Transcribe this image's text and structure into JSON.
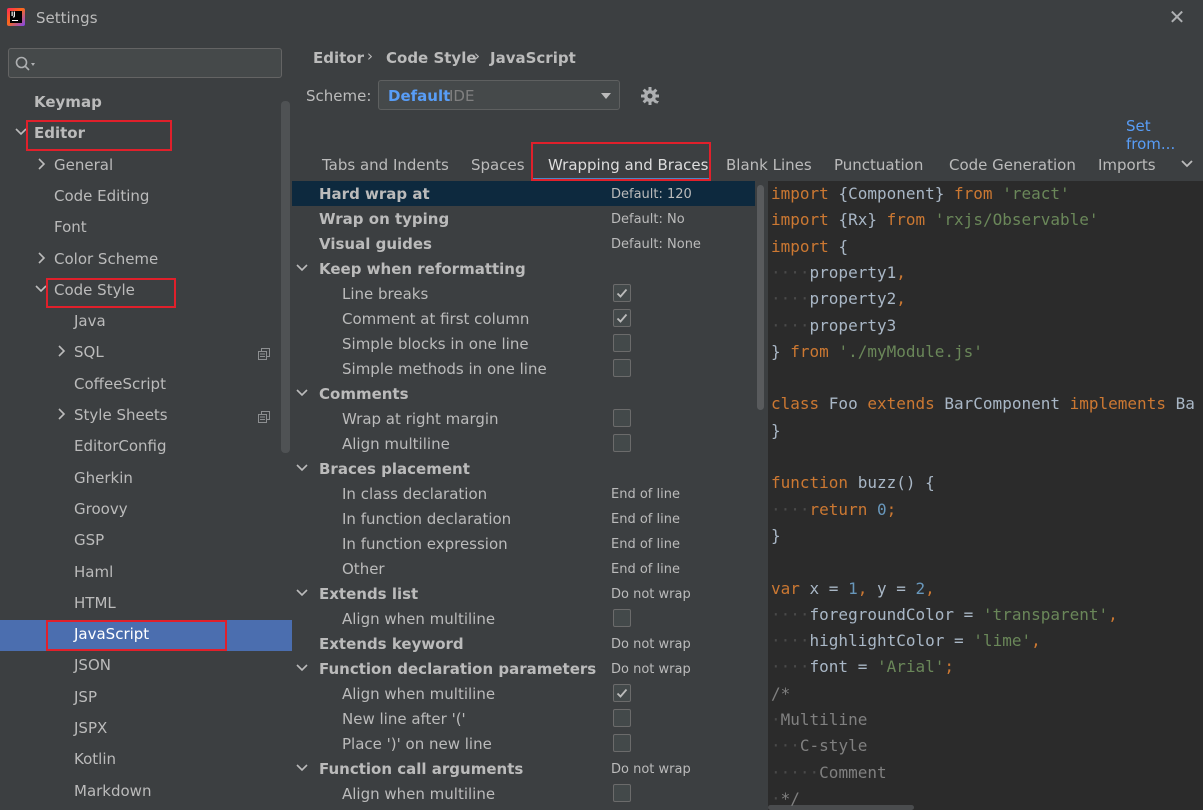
{
  "window": {
    "title": "Settings"
  },
  "search": {
    "placeholder": ""
  },
  "tree": [
    {
      "label": "Keymap",
      "bold": true,
      "indent": 0,
      "arrow": "none"
    },
    {
      "label": "Editor",
      "bold": true,
      "indent": 0,
      "arrow": "down"
    },
    {
      "label": "General",
      "bold": false,
      "indent": 1,
      "arrow": "right"
    },
    {
      "label": "Code Editing",
      "bold": false,
      "indent": 1,
      "arrow": "none"
    },
    {
      "label": "Font",
      "bold": false,
      "indent": 1,
      "arrow": "none"
    },
    {
      "label": "Color Scheme",
      "bold": false,
      "indent": 1,
      "arrow": "right"
    },
    {
      "label": "Code Style",
      "bold": false,
      "indent": 1,
      "arrow": "down"
    },
    {
      "label": "Java",
      "bold": false,
      "indent": 2,
      "arrow": "none"
    },
    {
      "label": "SQL",
      "bold": false,
      "indent": 2,
      "arrow": "right",
      "copy": true
    },
    {
      "label": "CoffeeScript",
      "bold": false,
      "indent": 2,
      "arrow": "none"
    },
    {
      "label": "Style Sheets",
      "bold": false,
      "indent": 2,
      "arrow": "right",
      "copy": true
    },
    {
      "label": "EditorConfig",
      "bold": false,
      "indent": 2,
      "arrow": "none"
    },
    {
      "label": "Gherkin",
      "bold": false,
      "indent": 2,
      "arrow": "none"
    },
    {
      "label": "Groovy",
      "bold": false,
      "indent": 2,
      "arrow": "none"
    },
    {
      "label": "GSP",
      "bold": false,
      "indent": 2,
      "arrow": "none"
    },
    {
      "label": "Haml",
      "bold": false,
      "indent": 2,
      "arrow": "none"
    },
    {
      "label": "HTML",
      "bold": false,
      "indent": 2,
      "arrow": "none"
    },
    {
      "label": "JavaScript",
      "bold": false,
      "indent": 2,
      "arrow": "none",
      "selected": true
    },
    {
      "label": "JSON",
      "bold": false,
      "indent": 2,
      "arrow": "none"
    },
    {
      "label": "JSP",
      "bold": false,
      "indent": 2,
      "arrow": "none"
    },
    {
      "label": "JSPX",
      "bold": false,
      "indent": 2,
      "arrow": "none"
    },
    {
      "label": "Kotlin",
      "bold": false,
      "indent": 2,
      "arrow": "none"
    },
    {
      "label": "Markdown",
      "bold": false,
      "indent": 2,
      "arrow": "none"
    }
  ],
  "breadcrumb": [
    "Editor",
    "Code Style",
    "JavaScript"
  ],
  "scheme": {
    "label": "Scheme:",
    "value": "Default",
    "suffix": "IDE"
  },
  "set_from": "Set from...",
  "tabs": [
    "Tabs and Indents",
    "Spaces",
    "Wrapping and Braces",
    "Blank Lines",
    "Punctuation",
    "Code Generation",
    "Imports"
  ],
  "active_tab": "Wrapping and Braces",
  "options": [
    {
      "label": "Hard wrap at",
      "bold": true,
      "level": 0,
      "value": "Default: 120",
      "highlight": true
    },
    {
      "label": "Wrap on typing",
      "bold": true,
      "level": 0,
      "value": "Default: No"
    },
    {
      "label": "Visual guides",
      "bold": true,
      "level": 0,
      "value": "Default: None"
    },
    {
      "label": "Keep when reformatting",
      "bold": true,
      "level": 0,
      "group": true
    },
    {
      "label": "Line breaks",
      "level": 1,
      "checkbox": true,
      "checked": true
    },
    {
      "label": "Comment at first column",
      "level": 1,
      "checkbox": true,
      "checked": true
    },
    {
      "label": "Simple blocks in one line",
      "level": 1,
      "checkbox": true,
      "checked": false
    },
    {
      "label": "Simple methods in one line",
      "level": 1,
      "checkbox": true,
      "checked": false
    },
    {
      "label": "Comments",
      "bold": true,
      "level": 0,
      "group": true
    },
    {
      "label": "Wrap at right margin",
      "level": 1,
      "checkbox": true,
      "checked": false
    },
    {
      "label": "Align multiline",
      "level": 1,
      "checkbox": true,
      "checked": false
    },
    {
      "label": "Braces placement",
      "bold": true,
      "level": 0,
      "group": true
    },
    {
      "label": "In class declaration",
      "level": 1,
      "value": "End of line"
    },
    {
      "label": "In function declaration",
      "level": 1,
      "value": "End of line"
    },
    {
      "label": "In function expression",
      "level": 1,
      "value": "End of line"
    },
    {
      "label": "Other",
      "level": 1,
      "value": "End of line"
    },
    {
      "label": "Extends list",
      "bold": true,
      "level": 0,
      "group": true,
      "value": "Do not wrap"
    },
    {
      "label": "Align when multiline",
      "level": 1,
      "checkbox": true,
      "checked": false
    },
    {
      "label": "Extends keyword",
      "bold": true,
      "level": 0,
      "value": "Do not wrap"
    },
    {
      "label": "Function declaration parameters",
      "bold": true,
      "level": 0,
      "group": true,
      "value": "Do not wrap"
    },
    {
      "label": "Align when multiline",
      "level": 1,
      "checkbox": true,
      "checked": true
    },
    {
      "label": "New line after '('",
      "level": 1,
      "checkbox": true,
      "checked": false
    },
    {
      "label": "Place ')' on new line",
      "level": 1,
      "checkbox": true,
      "checked": false
    },
    {
      "label": "Function call arguments",
      "bold": true,
      "level": 0,
      "group": true,
      "value": "Do not wrap"
    },
    {
      "label": "Align when multiline",
      "level": 1,
      "checkbox": true,
      "checked": false
    }
  ],
  "code": [
    [
      [
        "k",
        "import "
      ],
      [
        "p",
        "{Component} "
      ],
      [
        "k",
        "from "
      ],
      [
        "s",
        "'react'"
      ]
    ],
    [
      [
        "k",
        "import "
      ],
      [
        "p",
        "{Rx} "
      ],
      [
        "k",
        "from "
      ],
      [
        "s",
        "'rxjs/Observable'"
      ]
    ],
    [
      [
        "k",
        "import "
      ],
      [
        "p",
        "{"
      ]
    ],
    [
      [
        "d",
        "····"
      ],
      [
        "p",
        "property1"
      ],
      [
        "k",
        ","
      ]
    ],
    [
      [
        "d",
        "····"
      ],
      [
        "p",
        "property2"
      ],
      [
        "k",
        ","
      ]
    ],
    [
      [
        "d",
        "····"
      ],
      [
        "p",
        "property3"
      ]
    ],
    [
      [
        "p",
        "} "
      ],
      [
        "k",
        "from "
      ],
      [
        "s",
        "'./myModule.js'"
      ]
    ],
    [],
    [
      [
        "k",
        "class "
      ],
      [
        "p",
        "Foo "
      ],
      [
        "k",
        "extends "
      ],
      [
        "p",
        "BarComponent "
      ],
      [
        "k",
        "implements "
      ],
      [
        "p",
        "Ba"
      ]
    ],
    [
      [
        "p",
        "}"
      ]
    ],
    [],
    [
      [
        "k",
        "function "
      ],
      [
        "p",
        "buzz() {"
      ]
    ],
    [
      [
        "d",
        "····"
      ],
      [
        "k",
        "return "
      ],
      [
        "n",
        "0"
      ],
      [
        "k",
        ";"
      ]
    ],
    [
      [
        "p",
        "}"
      ]
    ],
    [],
    [
      [
        "k",
        "var "
      ],
      [
        "p",
        "x = "
      ],
      [
        "n",
        "1"
      ],
      [
        "k",
        ", "
      ],
      [
        "p",
        "y = "
      ],
      [
        "n",
        "2"
      ],
      [
        "k",
        ","
      ]
    ],
    [
      [
        "d",
        "····"
      ],
      [
        "p",
        "foregroundColor = "
      ],
      [
        "s",
        "'transparent'"
      ],
      [
        "k",
        ","
      ]
    ],
    [
      [
        "d",
        "····"
      ],
      [
        "p",
        "highlightColor = "
      ],
      [
        "s",
        "'lime'"
      ],
      [
        "k",
        ","
      ]
    ],
    [
      [
        "d",
        "····"
      ],
      [
        "p",
        "font = "
      ],
      [
        "s",
        "'Arial'"
      ],
      [
        "k",
        ";"
      ]
    ],
    [
      [
        "c",
        "/*"
      ]
    ],
    [
      [
        "d",
        "·"
      ],
      [
        "c",
        "Multiline"
      ]
    ],
    [
      [
        "d",
        "···"
      ],
      [
        "c",
        "C-style"
      ]
    ],
    [
      [
        "d",
        "·····"
      ],
      [
        "c",
        "Comment"
      ]
    ],
    [
      [
        "d",
        "·"
      ],
      [
        "c",
        "*/"
      ]
    ]
  ],
  "colors": {
    "selection": "#4b6eaf",
    "highlight_row": "#0d293e",
    "accent": "#589df6",
    "keyword": "#cc7832",
    "string": "#6a8759",
    "number": "#6897bb",
    "comment": "#808080",
    "annotation_box": "#e0202b"
  }
}
